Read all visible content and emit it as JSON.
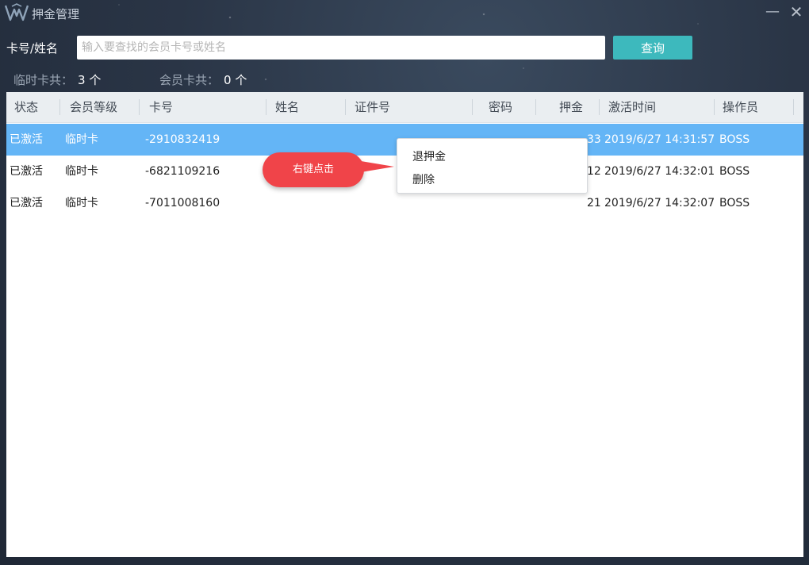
{
  "window": {
    "title": "押金管理",
    "minimize_glyph": "—",
    "close_glyph": "✕"
  },
  "search": {
    "label": "卡号/姓名",
    "placeholder": "输入要查找的会员卡号或姓名",
    "value": "",
    "button_label": "查询"
  },
  "counts": {
    "temp_label": "临时卡共：",
    "temp_value": "3 个",
    "member_label": "会员卡共：",
    "member_value": "0 个"
  },
  "table": {
    "columns": [
      "状态",
      "会员等级",
      "卡号",
      "姓名",
      "证件号",
      "密码",
      "押金",
      "激活时间",
      "操作员"
    ],
    "rows": [
      {
        "status": "已激活",
        "level": "临时卡",
        "card": "-2910832419",
        "name": "",
        "id_no": "",
        "password": "",
        "deposit": "33",
        "activated": "2019/6/27 14:31:57",
        "operator": "BOSS"
      },
      {
        "status": "已激活",
        "level": "临时卡",
        "card": "-6821109216",
        "name": "",
        "id_no": "",
        "password": "",
        "deposit": "12",
        "activated": "2019/6/27 14:32:01",
        "operator": "BOSS"
      },
      {
        "status": "已激活",
        "level": "临时卡",
        "card": "-7011008160",
        "name": "",
        "id_no": "",
        "password": "",
        "deposit": "21",
        "activated": "2019/6/27 14:32:07",
        "operator": "BOSS"
      }
    ],
    "selected_row": 0
  },
  "callout": {
    "text": "右键点击"
  },
  "context_menu": {
    "items": [
      "退押金",
      "删除"
    ]
  },
  "colors": {
    "accent_button": "#3db9bd",
    "selected_row": "#64b5f6",
    "callout": "#f04449"
  }
}
